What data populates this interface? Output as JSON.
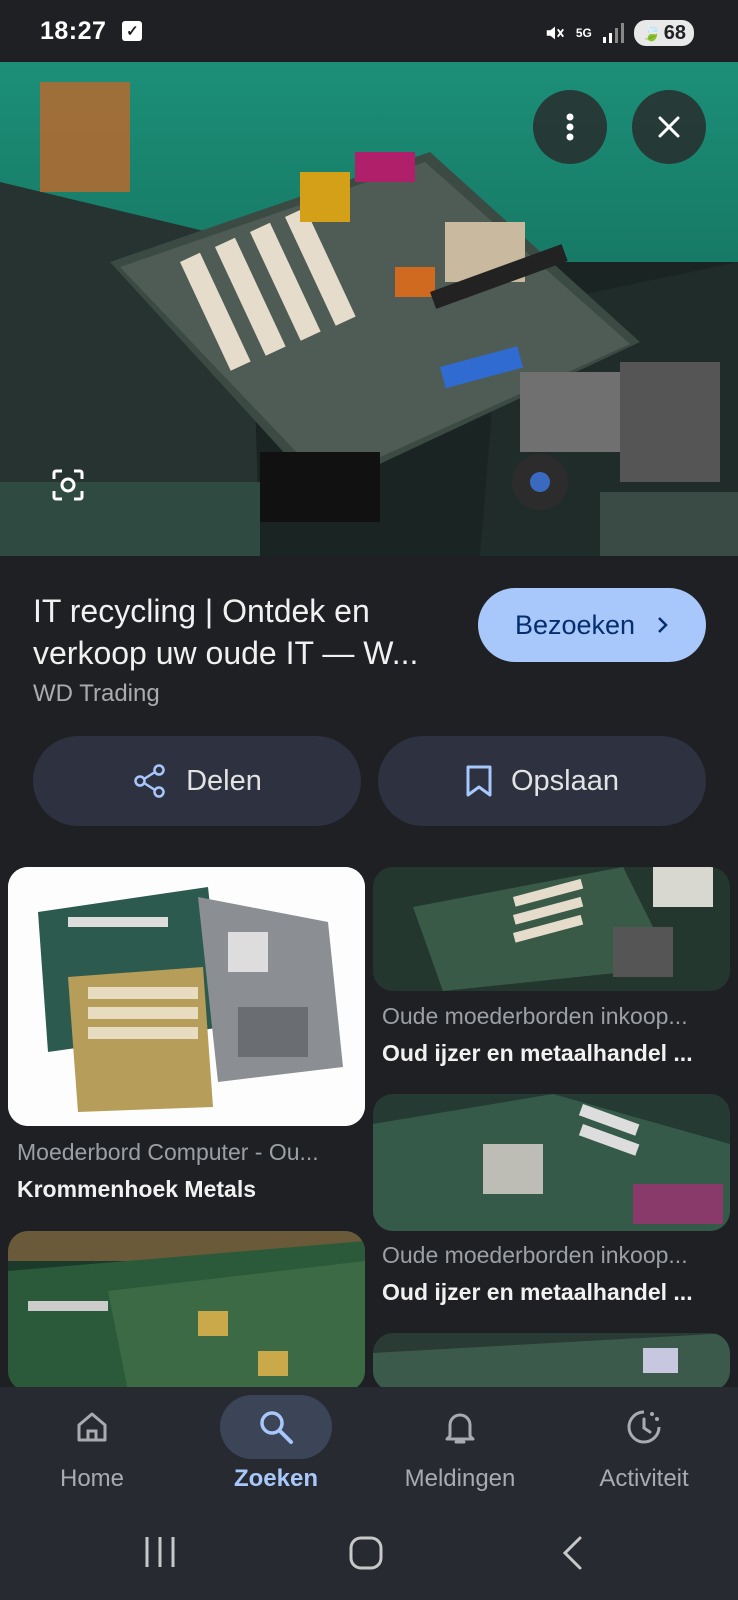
{
  "status_bar": {
    "time": "18:27",
    "network": "5G",
    "battery": "68"
  },
  "hero": {
    "icons": [
      "more-vert-icon",
      "close-icon",
      "lens-icon"
    ]
  },
  "result": {
    "title": "IT recycling | Ontdek en verkoop uw oude IT — W...",
    "source": "WD Trading",
    "visit_label": "Bezoeken"
  },
  "actions": {
    "share_label": "Delen",
    "save_label": "Opslaan"
  },
  "related": [
    {
      "caption": "Moederbord Computer - Ou...",
      "source": "Krommenhoek Metals"
    },
    {
      "caption": "Oude moederborden inkoop...",
      "source": "Oud ijzer en metaalhandel ..."
    },
    {
      "caption": "Oude moederborden inkoop...",
      "source": "Oud ijzer en metaalhandel ..."
    }
  ],
  "bottom_nav": {
    "items": [
      {
        "label": "Home",
        "icon": "home-icon"
      },
      {
        "label": "Zoeken",
        "icon": "search-icon"
      },
      {
        "label": "Meldingen",
        "icon": "bell-icon"
      },
      {
        "label": "Activiteit",
        "icon": "activity-icon"
      }
    ],
    "active": "Zoeken"
  },
  "colors": {
    "background": "#1f2023",
    "accent": "#a8c7fa",
    "card": "#2d3140"
  }
}
